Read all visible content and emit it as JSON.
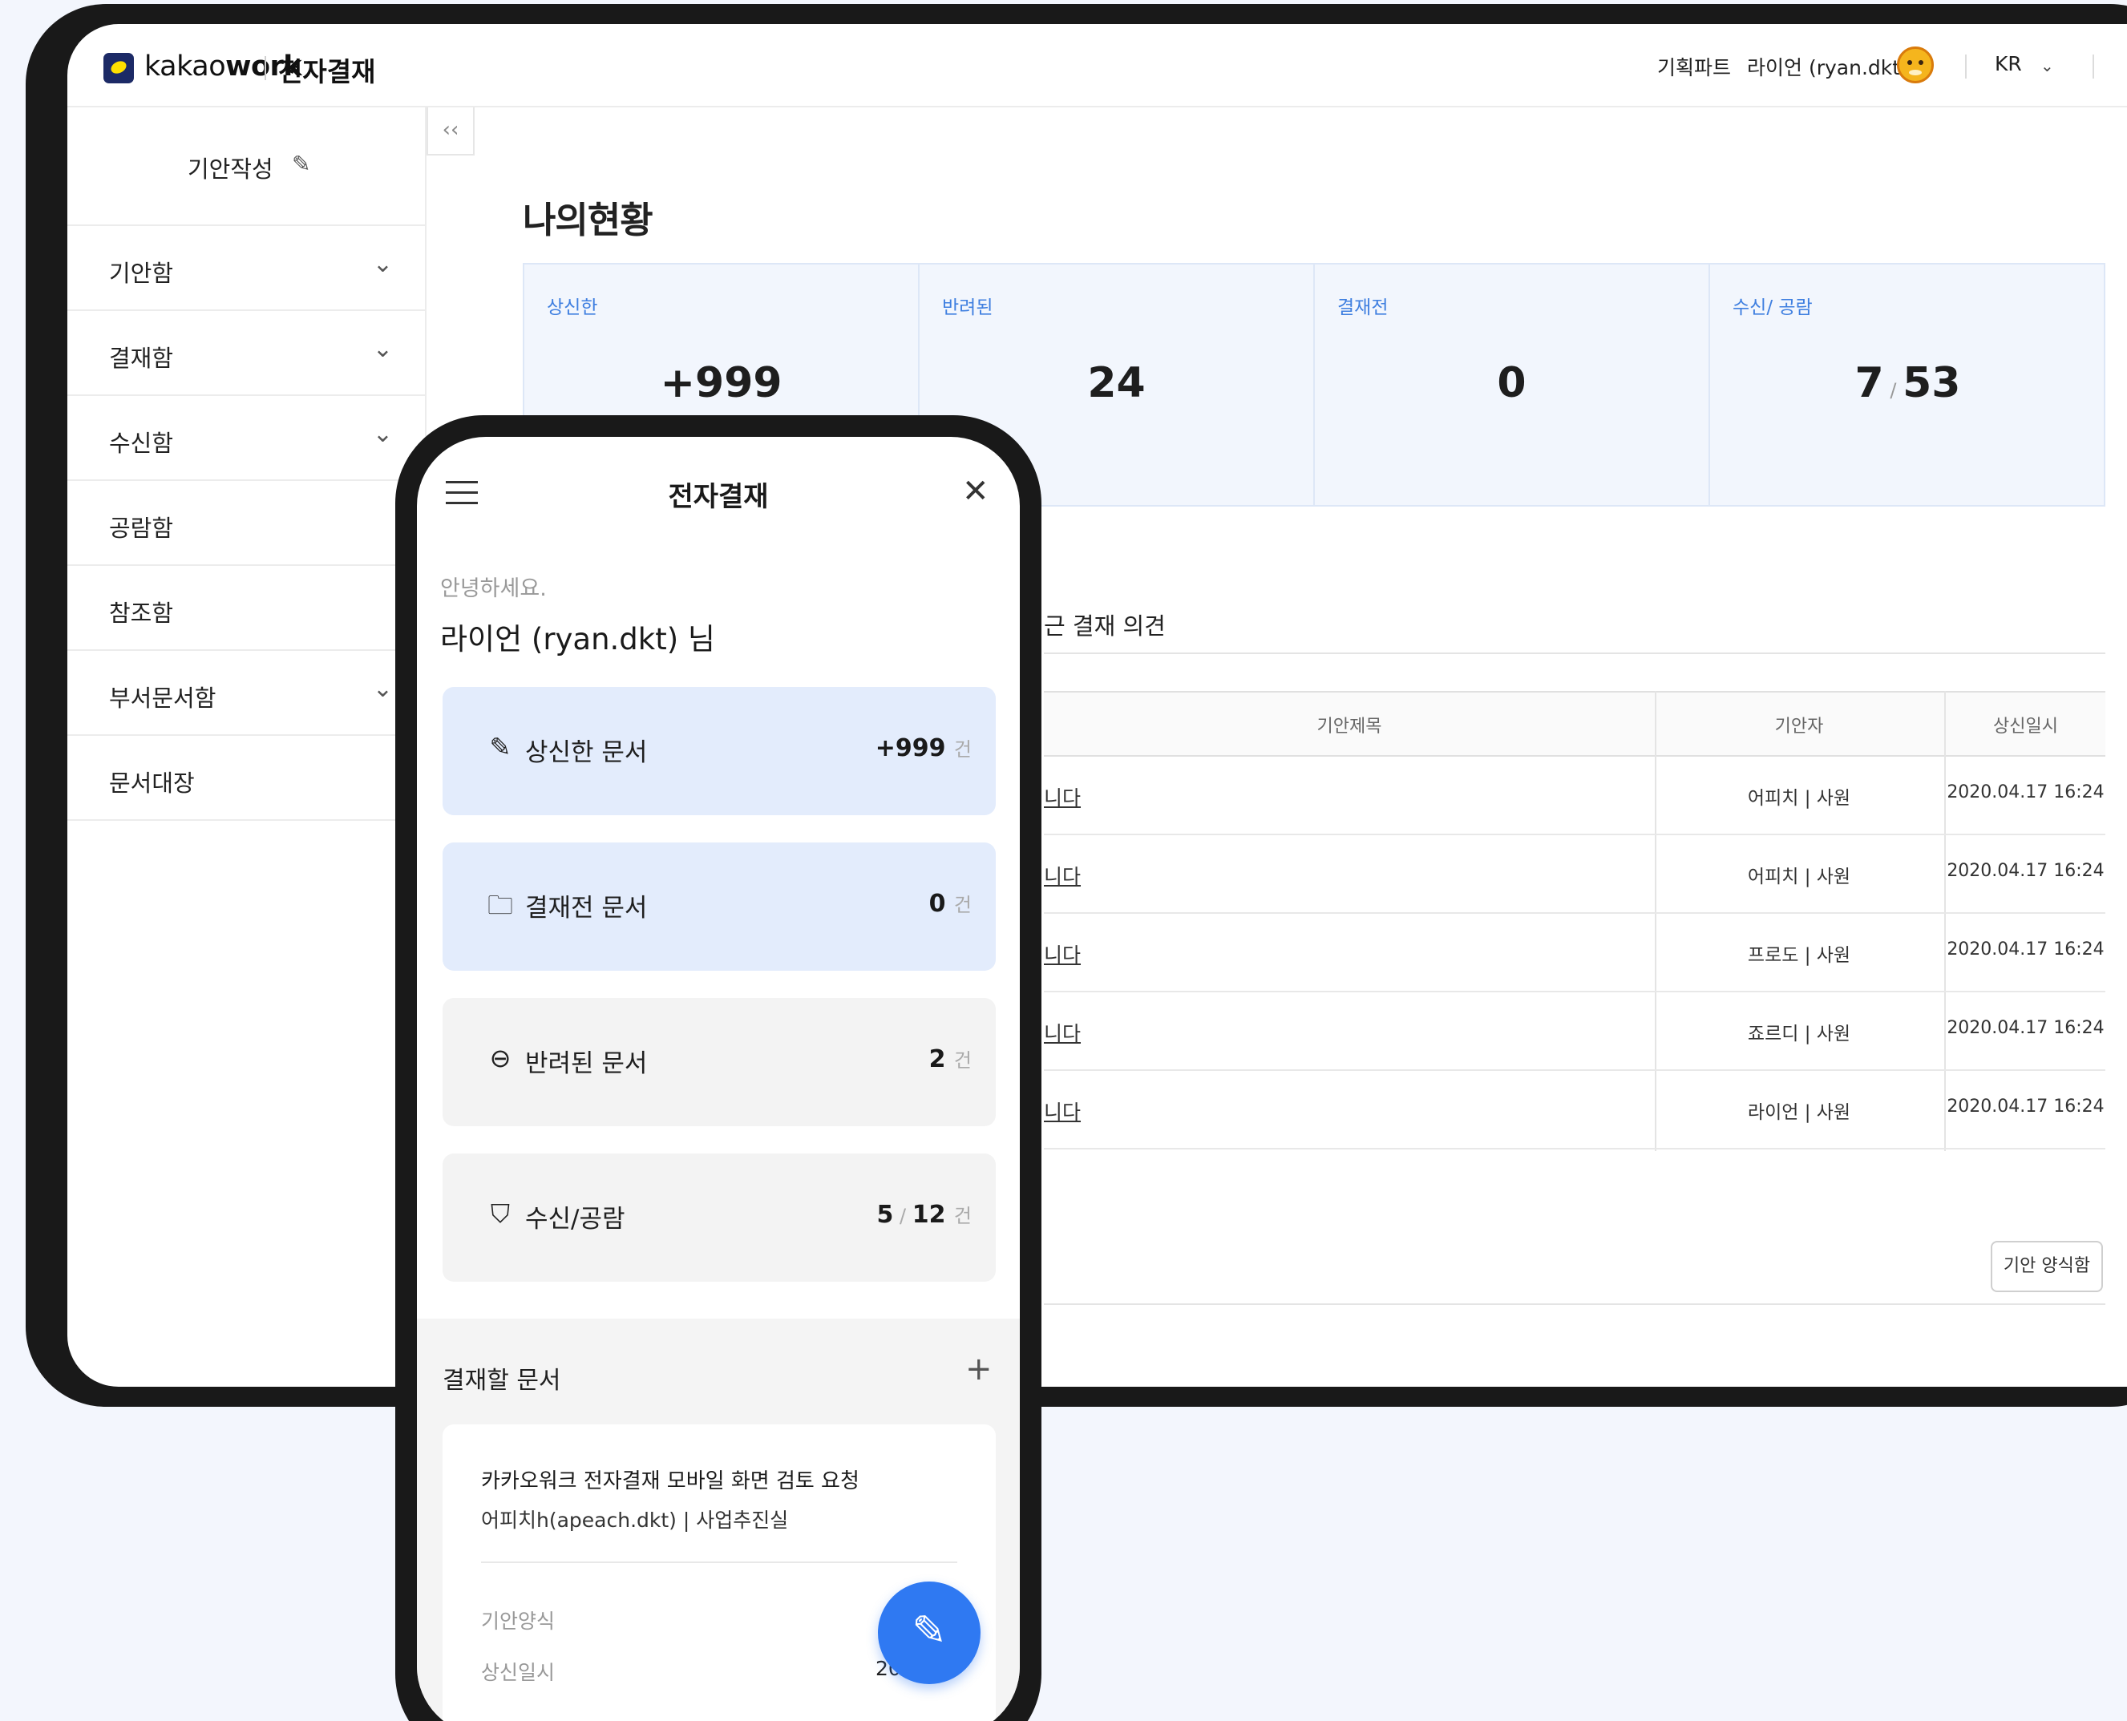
{
  "header": {
    "brand_normal": "kakao",
    "brand_bold": "work",
    "app_name": "전자결재",
    "department": "기획파트",
    "user": "라이언 (ryan.dkt)",
    "language": "KR"
  },
  "sidebar": {
    "compose_label": "기안작성",
    "collapse_glyph": "‹‹",
    "items": [
      {
        "label": "기안함",
        "has_children": true
      },
      {
        "label": "결재함",
        "has_children": true
      },
      {
        "label": "수신함",
        "has_children": true
      },
      {
        "label": "공람함",
        "has_children": false
      },
      {
        "label": "참조함",
        "has_children": false
      },
      {
        "label": "부서문서함",
        "has_children": true
      },
      {
        "label": "문서대장",
        "has_children": false
      }
    ]
  },
  "main": {
    "title": "나의현황",
    "stats": [
      {
        "label": "상신한",
        "value": "+999"
      },
      {
        "label": "반려된",
        "value": "24"
      },
      {
        "label": "결재전",
        "value": "0"
      },
      {
        "label": "수신/ 공람",
        "value_a": "7",
        "value_b": "53"
      }
    ],
    "recent_label": "근 결재 의견",
    "table": {
      "columns": [
        "기안제목",
        "기안자",
        "상신일시"
      ],
      "rows": [
        {
          "title": "니다",
          "drafter": "어피치 | 사원",
          "date": "2020.04.17 16:24"
        },
        {
          "title": "니다",
          "drafter": "어피치 | 사원",
          "date": "2020.04.17 16:24"
        },
        {
          "title": "니다",
          "drafter": "프로도 | 사원",
          "date": "2020.04.17 16:24"
        },
        {
          "title": "니다",
          "drafter": "죠르디 | 사원",
          "date": "2020.04.17 16:24"
        },
        {
          "title": "니다",
          "drafter": "라이언 | 사원",
          "date": "2020.04.17 16:24"
        }
      ]
    },
    "form_button": "기안 양식함"
  },
  "mobile": {
    "title": "전자결재",
    "greeting": "안녕하세요.",
    "user_name": "라이언 (ryan.dkt) 님",
    "unit": "건",
    "cards": [
      {
        "label": "상신한 문서",
        "value": "+999",
        "icon": "pencil-icon"
      },
      {
        "label": "결재전 문서",
        "value": "0",
        "icon": "folder-icon"
      },
      {
        "label": "반려된 문서",
        "value": "2",
        "icon": "minus-circle-icon"
      },
      {
        "label": "수신/공람",
        "value_a": "5",
        "value_b": "12",
        "icon": "bookmark-icon"
      }
    ],
    "pending_label": "결재할 문서",
    "doc": {
      "title": "카카오워크 전자결재 모바일 화면 검토 요청",
      "meta": "어피치h(apeach.dkt) | 사업추진실",
      "form_key": "기안양식",
      "date_key": "상신일시",
      "date_value": "20.0"
    }
  },
  "colors": {
    "accent": "#2f79f2",
    "stat_label": "#3f7fe0",
    "card_blue": "#e3ecfc",
    "frame": "#191919",
    "background": "#f3f6fd"
  }
}
